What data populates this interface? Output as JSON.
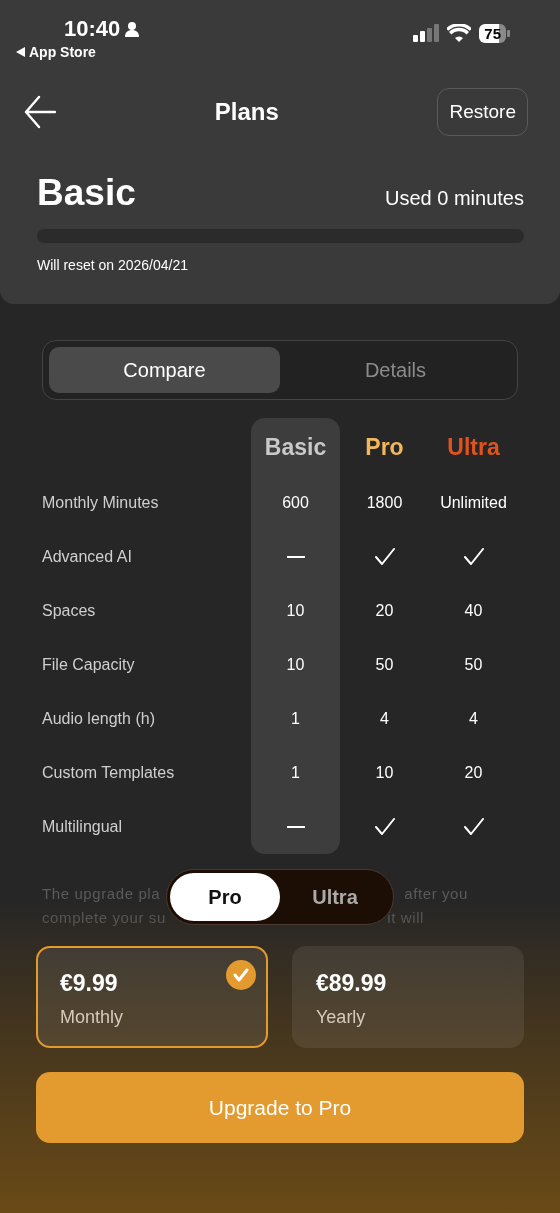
{
  "status_bar": {
    "time": "10:40",
    "back_app": "App Store",
    "battery": "75"
  },
  "header": {
    "title": "Plans",
    "restore": "Restore"
  },
  "plan": {
    "name": "Basic",
    "usage": "Used 0 minutes",
    "level": 0,
    "reset": "Will reset on 2026/04/21"
  },
  "tabs": [
    {
      "label": "Compare",
      "selected": true
    },
    {
      "label": "Details",
      "selected": false
    }
  ],
  "compare": {
    "columns": [
      {
        "name": "Basic",
        "color": "#c9c9c9",
        "selected": true
      },
      {
        "name": "Pro",
        "color": "#f2b75c",
        "selected": false
      },
      {
        "name": "Ultra",
        "color": "#e0531c",
        "selected": false
      }
    ],
    "rows": [
      {
        "label": "Monthly Minutes",
        "cells": [
          {
            "kind": "text",
            "text": "600"
          },
          {
            "kind": "text",
            "text": "1800"
          },
          {
            "kind": "text",
            "text": "Unlimited"
          }
        ]
      },
      {
        "label": "Advanced AI",
        "cells": [
          {
            "kind": "dash"
          },
          {
            "kind": "check"
          },
          {
            "kind": "check"
          }
        ]
      },
      {
        "label": "Spaces",
        "cells": [
          {
            "kind": "text",
            "text": "10"
          },
          {
            "kind": "text",
            "text": "20"
          },
          {
            "kind": "text",
            "text": "40"
          }
        ]
      },
      {
        "label": "File Capacity",
        "cells": [
          {
            "kind": "text",
            "text": "10"
          },
          {
            "kind": "text",
            "text": "50"
          },
          {
            "kind": "text",
            "text": "50"
          }
        ]
      },
      {
        "label": "Audio length (h)",
        "cells": [
          {
            "kind": "text",
            "text": "1"
          },
          {
            "kind": "text",
            "text": "4"
          },
          {
            "kind": "text",
            "text": "4"
          }
        ]
      },
      {
        "label": "Custom Templates",
        "cells": [
          {
            "kind": "text",
            "text": "1"
          },
          {
            "kind": "text",
            "text": "10"
          },
          {
            "kind": "text",
            "text": "20"
          }
        ]
      },
      {
        "label": "Multilingual",
        "cells": [
          {
            "kind": "dash"
          },
          {
            "kind": "check"
          },
          {
            "kind": "check"
          }
        ]
      }
    ]
  },
  "note": {
    "line_1_left": "The upgrade pla",
    "line_1_right": "after you",
    "line_2_left": "complete your su",
    "line_2_right": "it will"
  },
  "plan_toggle": [
    {
      "label": "Pro",
      "selected": true
    },
    {
      "label": "Ultra",
      "selected": false
    }
  ],
  "prices": [
    {
      "price": "€9.99",
      "period": "Monthly",
      "selected": true
    },
    {
      "price": "€89.99",
      "period": "Yearly",
      "selected": false
    }
  ],
  "upgrade_button": "Upgrade to Pro"
}
